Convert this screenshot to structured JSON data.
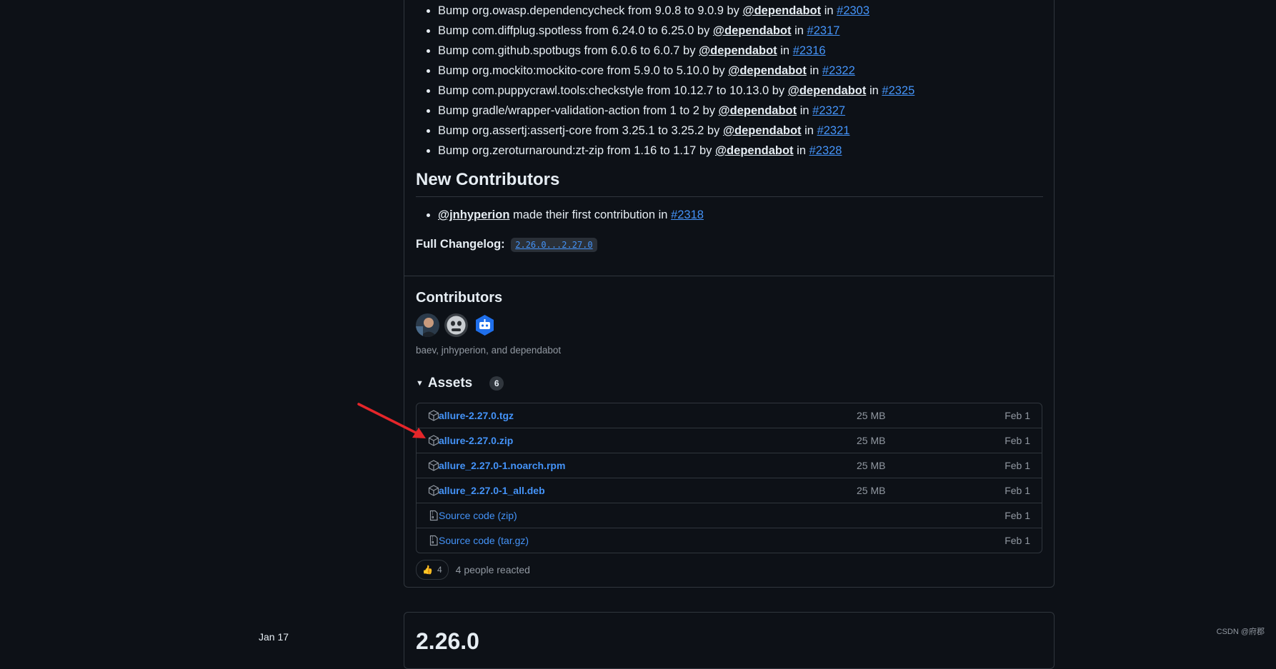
{
  "notes": {
    "bumps": [
      {
        "text": "Bump org.owasp.dependencycheck from 9.0.8 to 9.0.9 by",
        "mention": "@dependabot",
        "in": "in",
        "pr": "#2303"
      },
      {
        "text": "Bump com.diffplug.spotless from 6.24.0 to 6.25.0 by",
        "mention": "@dependabot",
        "in": "in",
        "pr": "#2317"
      },
      {
        "text": "Bump com.github.spotbugs from 6.0.6 to 6.0.7 by",
        "mention": "@dependabot",
        "in": "in",
        "pr": "#2316"
      },
      {
        "text": "Bump org.mockito:mockito-core from 5.9.0 to 5.10.0 by",
        "mention": "@dependabot",
        "in": "in",
        "pr": "#2322"
      },
      {
        "text": "Bump com.puppycrawl.tools:checkstyle from 10.12.7 to 10.13.0 by",
        "mention": "@dependabot",
        "in": "in",
        "pr": "#2325"
      },
      {
        "text": "Bump gradle/wrapper-validation-action from 1 to 2 by",
        "mention": "@dependabot",
        "in": "in",
        "pr": "#2327"
      },
      {
        "text": "Bump org.assertj:assertj-core from 3.25.1 to 3.25.2 by",
        "mention": "@dependabot",
        "in": "in",
        "pr": "#2321"
      },
      {
        "text": "Bump org.zeroturnaround:zt-zip from 1.16 to 1.17 by",
        "mention": "@dependabot",
        "in": "in",
        "pr": "#2328"
      }
    ],
    "new_contributors_heading": "New Contributors",
    "new_contributor": {
      "mention": "@jnhyperion",
      "text": "made their first contribution in",
      "pr": "#2318"
    },
    "changelog_label": "Full Changelog:",
    "changelog_link": "2.26.0...2.27.0"
  },
  "contributors": {
    "title": "Contributors",
    "names": "baev, jnhyperion, and dependabot"
  },
  "assets": {
    "title": "Assets",
    "count": "6",
    "rows": [
      {
        "name": "allure-2.27.0.tgz",
        "size": "25 MB",
        "date": "Feb 1",
        "icon": "package-icon"
      },
      {
        "name": "allure-2.27.0.zip",
        "size": "25 MB",
        "date": "Feb 1",
        "icon": "package-icon"
      },
      {
        "name": "allure_2.27.0-1.noarch.rpm",
        "size": "25 MB",
        "date": "Feb 1",
        "icon": "package-icon"
      },
      {
        "name": "allure_2.27.0-1_all.deb",
        "size": "25 MB",
        "date": "Feb 1",
        "icon": "package-icon"
      },
      {
        "name": "Source code",
        "paren": "(zip)",
        "size": "",
        "date": "Feb 1",
        "icon": "file-zip-icon"
      },
      {
        "name": "Source code",
        "paren": "(tar.gz)",
        "size": "",
        "date": "Feb 1",
        "icon": "file-zip-icon"
      }
    ]
  },
  "reaction": {
    "emoji": "👍",
    "count": "4",
    "text": "4 people reacted"
  },
  "next_release": {
    "version": "2.26.0",
    "date": "Jan 17"
  },
  "watermark": "CSDN @府郡",
  "colors": {
    "background": "#0d1117",
    "border": "#30363d",
    "link": "#4493f8",
    "muted": "#9198a1",
    "annotation_arrow": "#e5262a"
  }
}
